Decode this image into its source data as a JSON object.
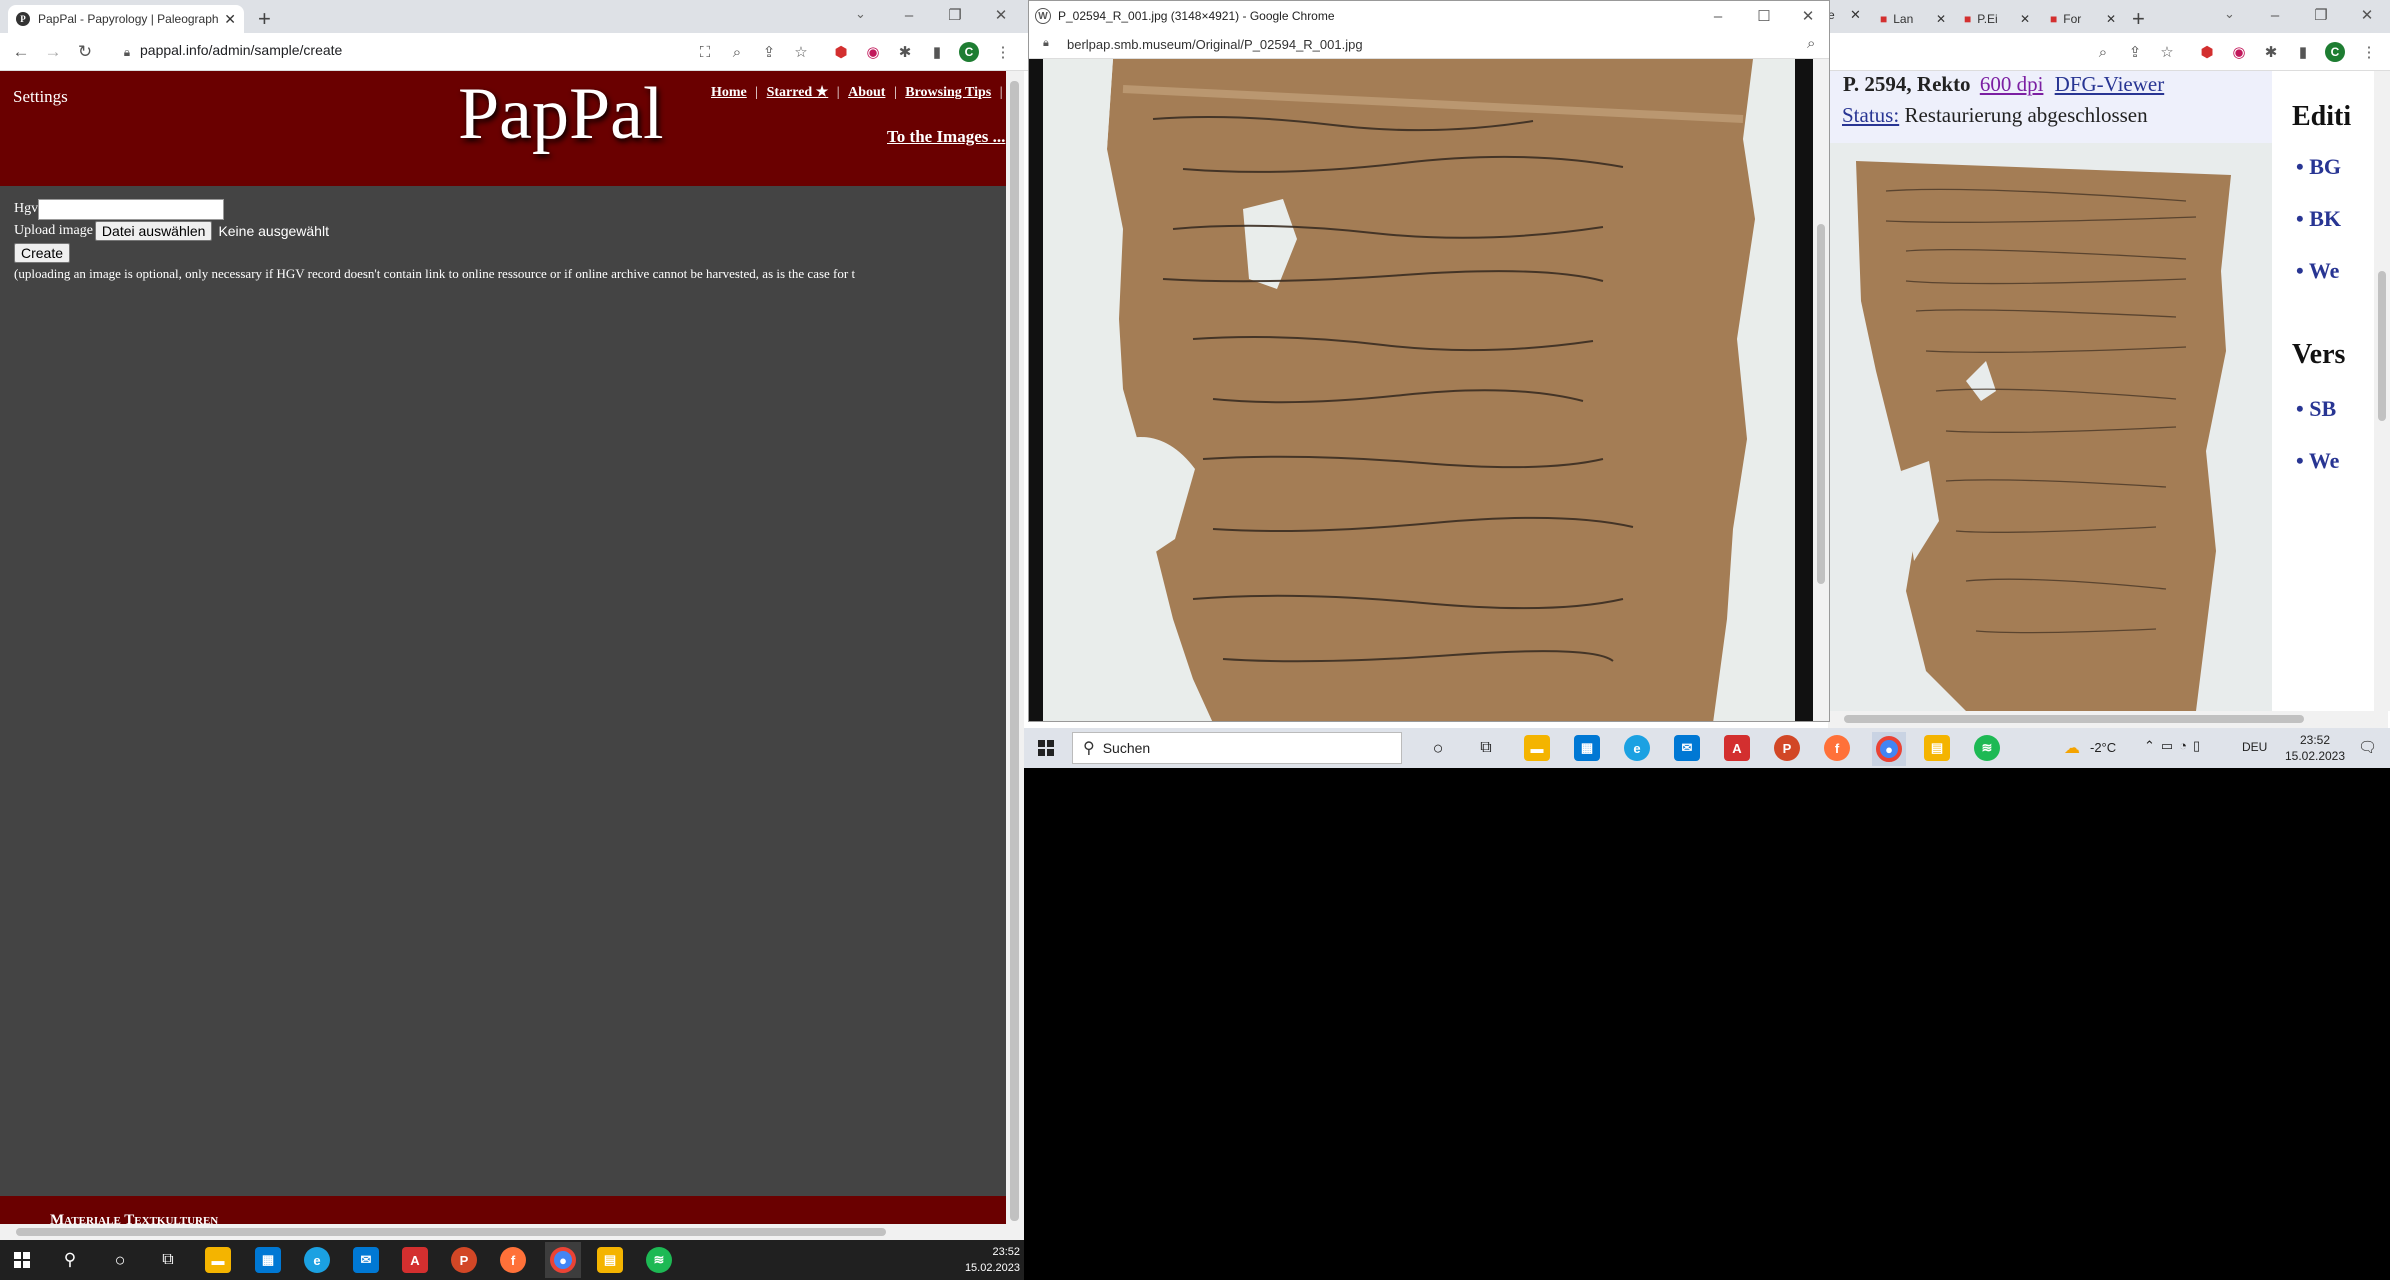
{
  "left_browser": {
    "tab_title": "PapPal - Papyrology | Paleograph",
    "favicon_letter": "P",
    "url": "pappal.info/admin/sample/create",
    "profile_initial": "C",
    "header": {
      "settings": "Settings",
      "logo": "PapPal",
      "nav": [
        "Home",
        "Starred ★",
        "About",
        "Browsing Tips"
      ],
      "nav_sep": "|",
      "images_link": "To the Images ..."
    },
    "form": {
      "hgv_label": "Hgv",
      "hgv_value": "",
      "upload_label": "Upload image",
      "file_button": "Datei auswählen",
      "file_status": "Keine ausgewählt",
      "create_button": "Create",
      "note": "(uploading an image is optional, only necessary if HGV record doesn't contain link to online ressource or if online archive cannot be harvested, as is the case for t"
    },
    "footer_text": "Materiale Textkulturen"
  },
  "popup_window": {
    "title": "P_02594_R_001.jpg (3148×4921) - Google Chrome",
    "url": "berlpap.smb.museum/Original/P_02594_R_001.jpg"
  },
  "right_browser": {
    "tabs": [
      "Lan",
      "P.Ei",
      "For"
    ],
    "profile_initial": "C",
    "caption": {
      "prefix": "P. 2594, Rekto",
      "dpi_link": "600 dpi",
      "viewer_link": "DFG-Viewer",
      "status_label": "Status:",
      "status_value": "Restaurierung abgeschlossen"
    },
    "side": {
      "heading1": "Editi",
      "items1": [
        "BG",
        "BK",
        "We"
      ],
      "heading2": "Vers",
      "items2": [
        "SB",
        "We"
      ]
    }
  },
  "taskbars": {
    "search_placeholder": "Suchen",
    "weather": "-2°C",
    "lang": "DEU",
    "time": "23:52",
    "date": "15.02.2023"
  },
  "colors": {
    "pappal_red": "#6a0000",
    "page_bg": "#444444",
    "link_blue": "#283593",
    "papyrus": "#a47d55"
  },
  "icons": [
    "windows-start-icon",
    "search-icon",
    "cortana-icon",
    "task-view-icon",
    "file-explorer-icon",
    "store-icon",
    "edge-icon",
    "mail-icon",
    "acrobat-icon",
    "powerpoint-icon",
    "firefox-icon",
    "chrome-icon",
    "file-icon",
    "spotify-icon"
  ]
}
